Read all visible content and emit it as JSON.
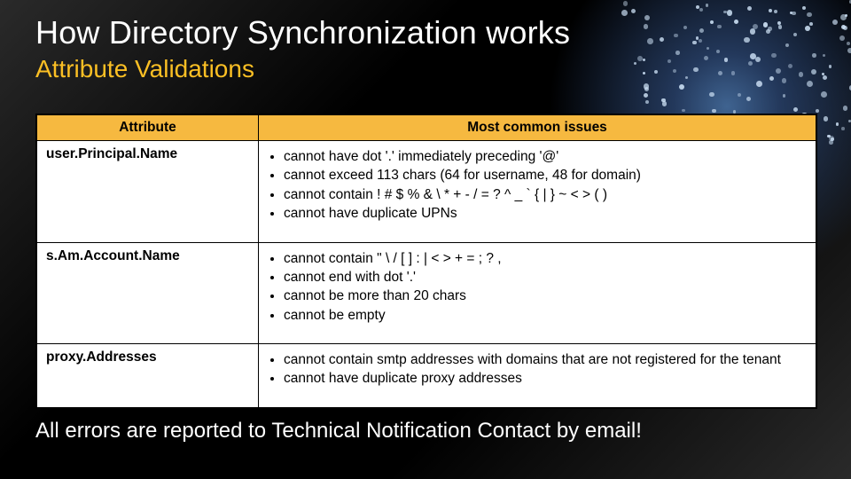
{
  "header": {
    "title": "How Directory Synchronization works",
    "subtitle": "Attribute Validations"
  },
  "table": {
    "columns": [
      "Attribute",
      "Most common issues"
    ],
    "rows": [
      {
        "attribute": "user.Principal.Name",
        "issues": [
          "cannot have dot '.' immediately preceding '@'",
          "cannot exceed 113 chars (64 for username, 48 for domain)",
          "cannot contain ! # $ % & \\ * + - / = ? ^ _ ` { | } ~ < > ( )",
          "cannot have duplicate UPNs"
        ]
      },
      {
        "attribute": "s.Am.Account.Name",
        "issues": [
          "cannot contain \" \\ / [ ] : | < > + = ; ? ,",
          "cannot end with dot '.'",
          "cannot be more than 20 chars",
          "cannot be empty"
        ]
      },
      {
        "attribute": "proxy.Addresses",
        "issues": [
          "cannot contain smtp addresses with domains that are not registered for the tenant",
          "cannot have duplicate proxy addresses"
        ]
      }
    ]
  },
  "footer": "All errors are reported to Technical Notification Contact by email!"
}
